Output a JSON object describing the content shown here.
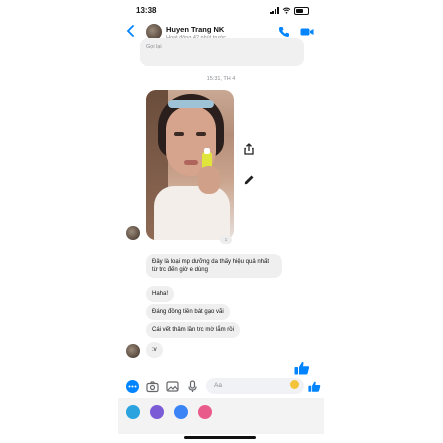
{
  "status_bar": {
    "time": "13:38"
  },
  "header": {
    "contact_name": "Huyen Trang NK",
    "contact_status": "Hoạt động 42 phút trước"
  },
  "previous_message": {
    "text": "Gọi lại"
  },
  "timestamp": "15:31, TH 4",
  "photo": {
    "count": "1"
  },
  "messages": [
    {
      "text": "Đây là loại mp dưỡng da thấy hiệu quả nhất từ trc đến giờ e dùng"
    },
    {
      "text": "Haha!"
    },
    {
      "text": "Đáng đồng tiền bát gạo vãi"
    },
    {
      "text": "Cái vết thâm lần trc mờ lắm rồi"
    },
    {
      "text": ":v"
    }
  ],
  "composer": {
    "placeholder": "Aa"
  },
  "colors": {
    "accent": "#0084ff",
    "bubble": "#efefef",
    "app_telegram": "#2aa3df",
    "app_viber": "#7b5bd6",
    "app_signal": "#3a84f5",
    "app_other": "#e85b8b"
  },
  "icons": {
    "back": "chevron-left-icon",
    "call": "phone-icon",
    "video": "video-camera-icon",
    "share": "share-icon",
    "edit": "pencil-icon",
    "like": "thumbs-up-icon",
    "menu": "more-icon",
    "camera": "camera-icon",
    "gallery": "image-icon",
    "mic": "microphone-icon",
    "emoji": "emoji-icon"
  }
}
